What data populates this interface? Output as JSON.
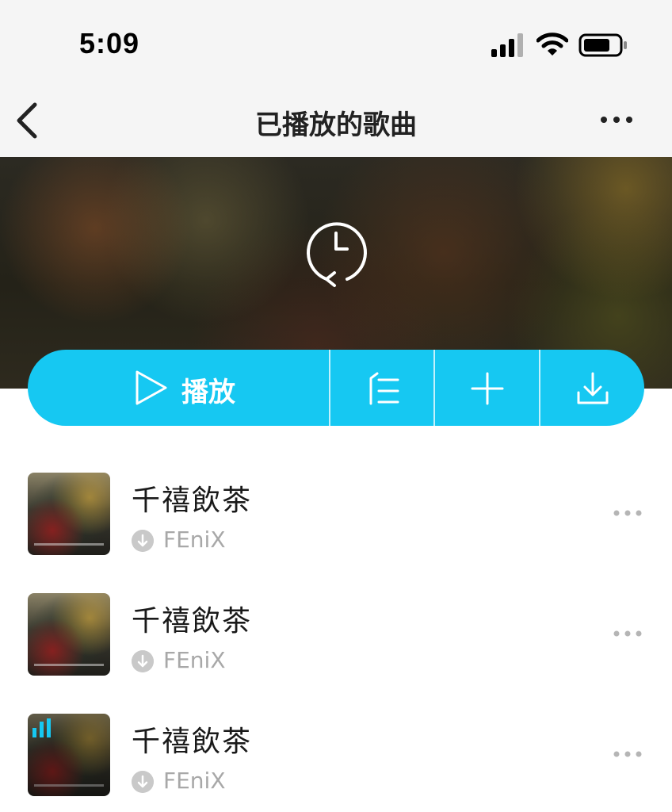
{
  "status_bar": {
    "time": "5:09"
  },
  "nav": {
    "title": "已播放的歌曲"
  },
  "banner": {
    "icon": "history-clock-icon"
  },
  "actions": {
    "play_label": "播放",
    "icons": [
      "play-icon",
      "sort-list-icon",
      "add-icon",
      "download-icon"
    ],
    "color": "#16c8f2"
  },
  "songs": [
    {
      "title": "千禧飲茶",
      "artist": "FEniX",
      "playing": false
    },
    {
      "title": "千禧飲茶",
      "artist": "FEniX",
      "playing": false
    },
    {
      "title": "千禧飲茶",
      "artist": "FEniX",
      "playing": true
    }
  ],
  "colors": {
    "accent": "#16c8f2",
    "artist_text": "#a8a8a8",
    "title_text": "#1a1a1a"
  }
}
